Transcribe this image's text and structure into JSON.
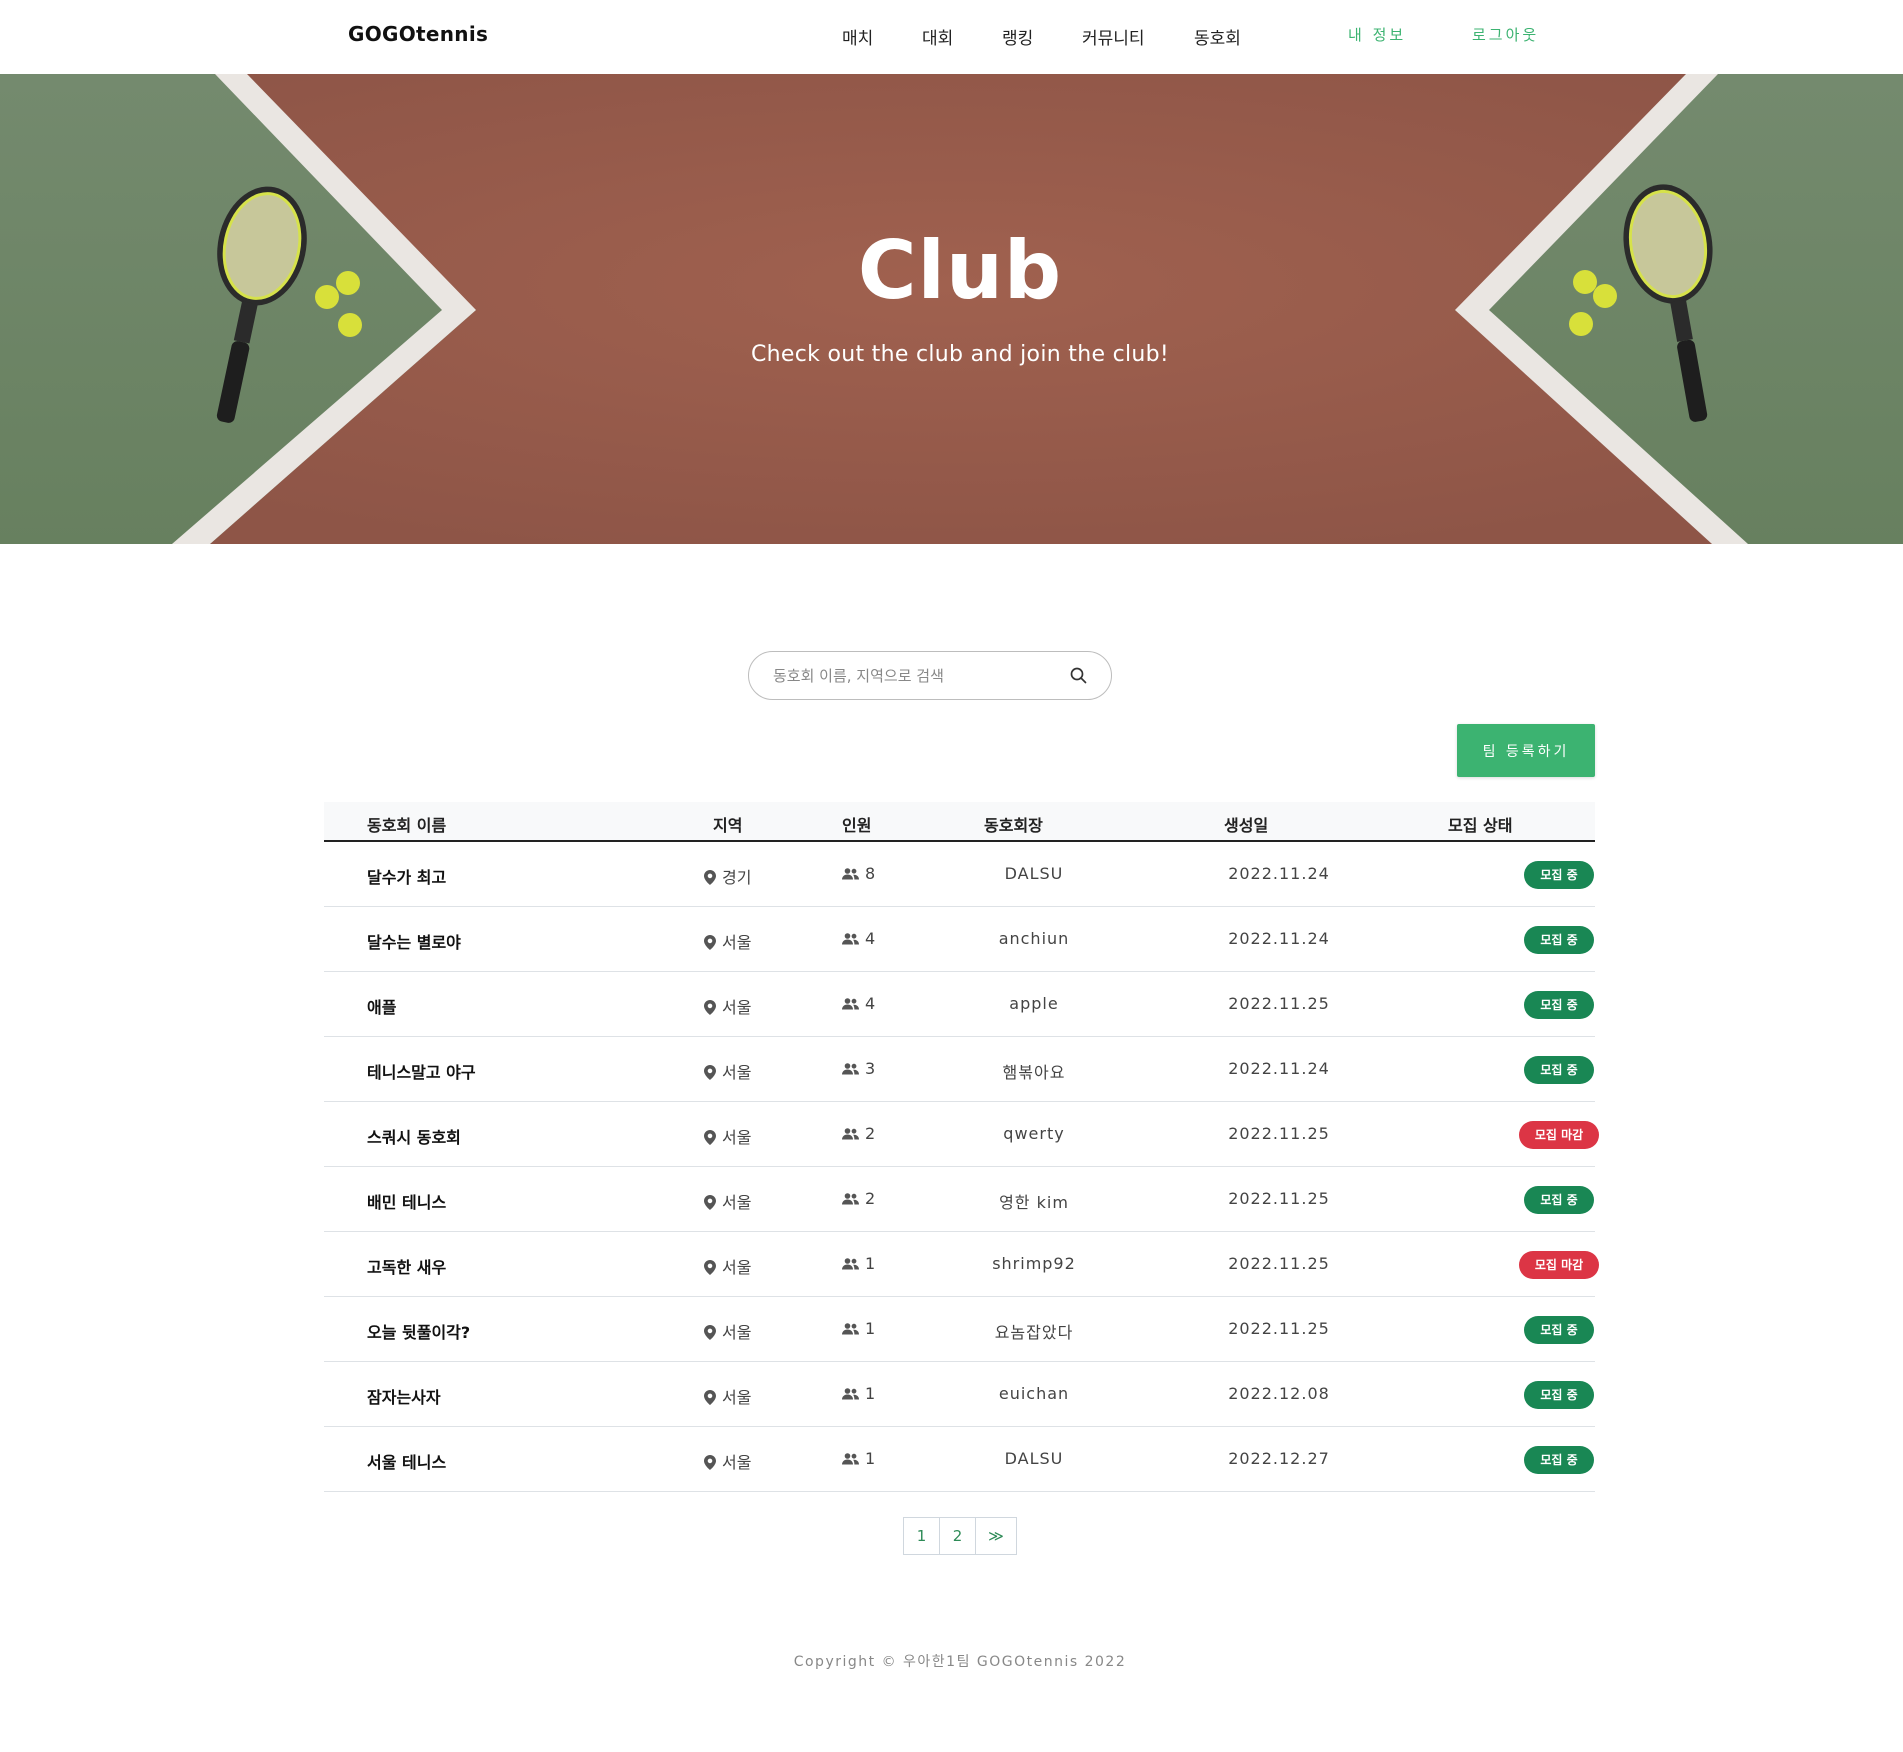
{
  "header": {
    "logo": "GOGOtennis",
    "nav": [
      "매치",
      "대회",
      "랭킹",
      "커뮤니티",
      "동호회"
    ],
    "my_info": "내 정보",
    "logout": "로그아웃"
  },
  "hero": {
    "title": "Club",
    "subtitle": "Check out the club and join the club!"
  },
  "search": {
    "placeholder": "동호회 이름, 지역으로 검색",
    "icon": "search-icon"
  },
  "register_button": "팀 등록하기",
  "table": {
    "headers": [
      "동호회 이름",
      "지역",
      "인원",
      "동호회장",
      "생성일",
      "모집 상태"
    ],
    "rows": [
      {
        "name": "달수가 최고",
        "region": "경기",
        "members": "8",
        "captain": "DALSU",
        "created": "2022.11.24",
        "status": "모집 중"
      },
      {
        "name": "달수는 별로야",
        "region": "서울",
        "members": "4",
        "captain": "anchiun",
        "created": "2022.11.24",
        "status": "모집 중"
      },
      {
        "name": "애플",
        "region": "서울",
        "members": "4",
        "captain": "apple",
        "created": "2022.11.25",
        "status": "모집 중"
      },
      {
        "name": "테니스말고 야구",
        "region": "서울",
        "members": "3",
        "captain": "햄볶아요",
        "created": "2022.11.24",
        "status": "모집 중"
      },
      {
        "name": "스쿼시 동호회",
        "region": "서울",
        "members": "2",
        "captain": "qwerty",
        "created": "2022.11.25",
        "status": "모집 마감"
      },
      {
        "name": "배민 테니스",
        "region": "서울",
        "members": "2",
        "captain": "영한 kim",
        "created": "2022.11.25",
        "status": "모집 중"
      },
      {
        "name": "고독한 새우",
        "region": "서울",
        "members": "1",
        "captain": "shrimp92",
        "created": "2022.11.25",
        "status": "모집 마감"
      },
      {
        "name": "오늘 뒷풀이각?",
        "region": "서울",
        "members": "1",
        "captain": "요놈잡았다",
        "created": "2022.11.25",
        "status": "모집 중"
      },
      {
        "name": "잠자는사자",
        "region": "서울",
        "members": "1",
        "captain": "euichan",
        "created": "2022.12.08",
        "status": "모집 중"
      },
      {
        "name": "서울 테니스",
        "region": "서울",
        "members": "1",
        "captain": "DALSU",
        "created": "2022.12.27",
        "status": "모집 중"
      }
    ]
  },
  "pagination": {
    "pages": [
      "1",
      "2"
    ],
    "next": "≫",
    "current": "1"
  },
  "footer": {
    "copyright": "Copyright © 우아한1팀 GOGOtennis 2022"
  },
  "colors": {
    "accent": "#3cb371",
    "status_open": "#198754",
    "status_closed": "#dc3545",
    "clay": "#9a5b4e",
    "court_green": "#6f8568"
  }
}
